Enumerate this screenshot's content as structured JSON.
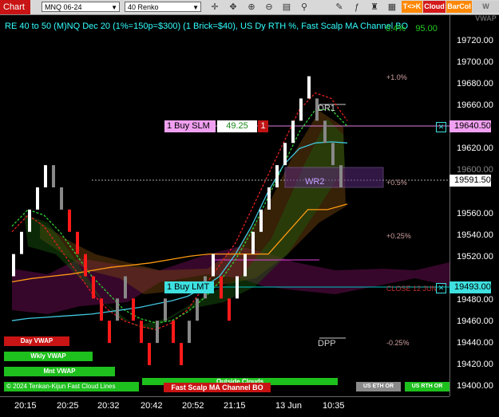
{
  "toolbar": {
    "chart_tab": "Chart",
    "instrument": "MNQ 06-24",
    "bar_type": "40 Renko",
    "icons": [
      "crosshair-icon",
      "pan-icon",
      "zoom-in-icon",
      "zoom-out-icon",
      "properties-icon",
      "drawing-icon",
      "pencil-icon",
      "indicators-icon",
      "strategies-icon"
    ],
    "buttons": [
      {
        "label": "T<>K",
        "color": "#ff8800"
      },
      {
        "label": "Cloud",
        "color": "#d41a1a"
      },
      {
        "label": "BarCol",
        "color": "#ff8800"
      },
      {
        "label": "W VWAP",
        "color": "#cfcfcf"
      }
    ]
  },
  "chart": {
    "title": "RE 40 to 50 (M)NQ Dec 20 (1%=150p=$300) (1 Brick=$40), US Dy RTH %, Fast Scalp MA Channel BO",
    "title_extra": "0.4%",
    "title_extra2": "95.00",
    "y_ticks": [
      "19720.00",
      "19700.00",
      "19680.00",
      "19660.00",
      "19620.00",
      "19600.00",
      "19560.00",
      "19540.00",
      "19520.00",
      "19480.00",
      "19460.00",
      "19440.00",
      "19420.00",
      "19400.00"
    ],
    "x_ticks": [
      "20:15",
      "20:25",
      "20:32",
      "20:42",
      "20:52",
      "21:15",
      "13 Jun",
      "10:35"
    ],
    "pct_levels": [
      "+1.0%",
      "+0.5%",
      "+0.25%",
      "-0.25%"
    ],
    "close_label": "CLOSE 12 JUN",
    "dr1": "DR1",
    "wr2": "WR2",
    "dpp": "DPP",
    "orders": {
      "buy_slm": "1 Buy SLM",
      "buy_slm_price": "49.25",
      "buy_slm_qty": "1",
      "buy_lmt": "1 Buy LMT"
    },
    "price_boxes": {
      "slm": "19640.50",
      "last": "19591.50",
      "lmt": "19493.00"
    },
    "labels": {
      "day_vwap": "Day VWAP",
      "wkly_vwap": "Wkly VWAP",
      "mnt_vwap": "Mnt VWAP",
      "outside_clouds": "Outside Clouds",
      "fast_scalp": "Fast Scalp MA Channel BO",
      "copyright": "© 2024 Tenkan-Kijun Fast Cloud Lines",
      "us_eth_or": "US ETH OR",
      "us_rth_or": "US RTH OR"
    }
  },
  "chart_data": {
    "type": "line",
    "ylim": [
      19392,
      19735
    ],
    "bricks": [
      [
        19520,
        "w"
      ],
      [
        19540,
        "w"
      ],
      [
        19560,
        "w"
      ],
      [
        19580,
        "w"
      ],
      [
        19600,
        "w"
      ],
      [
        19600,
        "g"
      ],
      [
        19580,
        "g"
      ],
      [
        19560,
        "r"
      ],
      [
        19540,
        "r"
      ],
      [
        19520,
        "r"
      ],
      [
        19500,
        "r"
      ],
      [
        19480,
        "r"
      ],
      [
        19460,
        "r"
      ],
      [
        19480,
        "g"
      ],
      [
        19500,
        "g"
      ],
      [
        19480,
        "r"
      ],
      [
        19460,
        "r"
      ],
      [
        19440,
        "r"
      ],
      [
        19460,
        "g"
      ],
      [
        19480,
        "g"
      ],
      [
        19460,
        "r"
      ],
      [
        19440,
        "r"
      ],
      [
        19460,
        "g"
      ],
      [
        19480,
        "g"
      ],
      [
        19500,
        "g"
      ],
      [
        19520,
        "w"
      ],
      [
        19500,
        "r"
      ],
      [
        19480,
        "r"
      ],
      [
        19500,
        "w"
      ],
      [
        19520,
        "w"
      ],
      [
        19540,
        "w"
      ],
      [
        19560,
        "w"
      ],
      [
        19580,
        "w"
      ],
      [
        19600,
        "w"
      ],
      [
        19620,
        "w"
      ],
      [
        19640,
        "w"
      ],
      [
        19660,
        "w"
      ],
      [
        19680,
        "w"
      ],
      [
        19660,
        "g"
      ],
      [
        19640,
        "g"
      ],
      [
        19620,
        "g"
      ],
      [
        19600,
        "g"
      ]
    ],
    "lines": {
      "tenkan_red": [
        19540,
        19555,
        19545,
        19525,
        19505,
        19485,
        19470,
        19460,
        19455,
        19452,
        19458,
        19470,
        19490,
        19510,
        19530,
        19560,
        19590,
        19620,
        19650,
        19665,
        19660,
        19640
      ],
      "kijun_green": [
        19545,
        19560,
        19555,
        19540,
        19520,
        19500,
        19485,
        19470,
        19462,
        19458,
        19460,
        19468,
        19480,
        19495,
        19515,
        19540,
        19570,
        19600,
        19630,
        19650,
        19650,
        19635
      ],
      "cyan_ma": [
        19460,
        19462,
        19463,
        19464,
        19465,
        19466,
        19468,
        19470,
        19472,
        19475,
        19478,
        19482,
        19490,
        19500,
        19520,
        19545,
        19575,
        19600,
        19615,
        19620,
        19621,
        19620
      ],
      "orange_band": [
        19495,
        19498,
        19500,
        19502,
        19505,
        19508,
        19510,
        19512,
        19515,
        19518,
        19520,
        19520,
        19520,
        19520,
        19540,
        19560,
        19560,
        19565
      ]
    }
  }
}
